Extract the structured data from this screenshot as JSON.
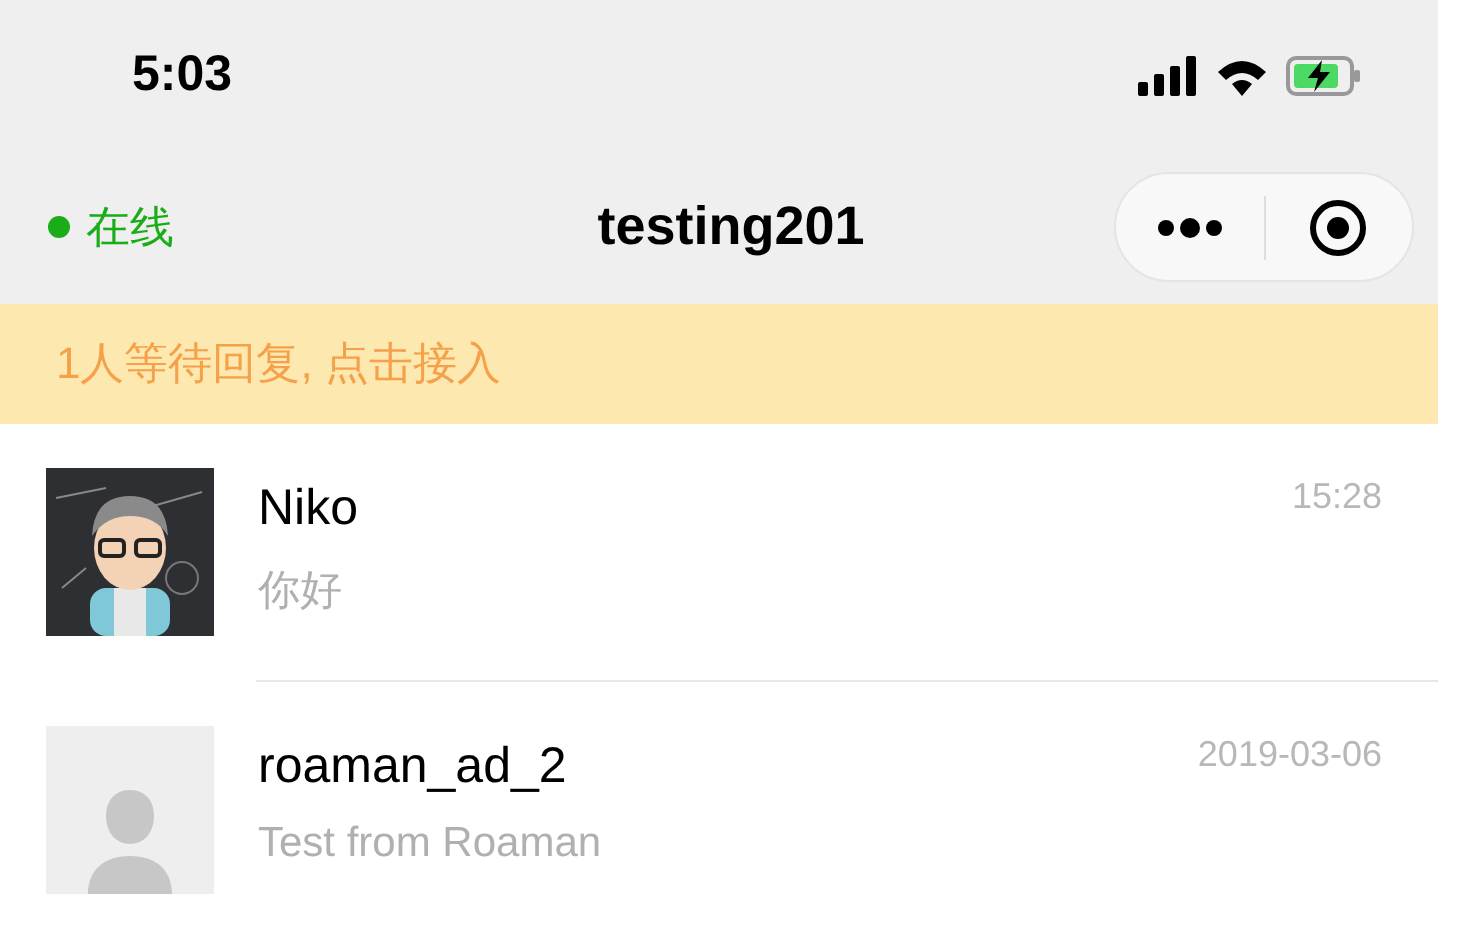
{
  "status_bar": {
    "time": "5:03"
  },
  "nav": {
    "status": {
      "label": "在线",
      "online": true
    },
    "title": "testing201"
  },
  "banner": {
    "text": "1人等待回复, 点击接入"
  },
  "conversations": [
    {
      "name": "Niko",
      "preview": "你好",
      "time": "15:28",
      "kind": "picture"
    },
    {
      "name": "roaman_ad_2",
      "preview": "Test from Roaman",
      "time": "2019-03-06",
      "kind": "placeholder"
    }
  ]
}
